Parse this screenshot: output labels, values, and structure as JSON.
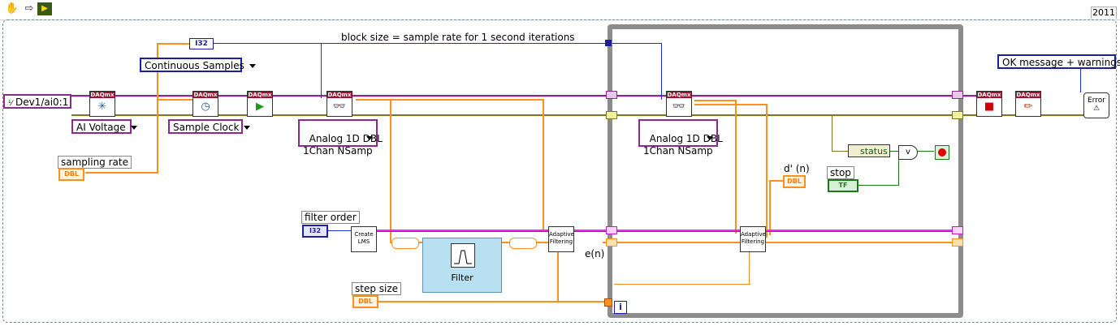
{
  "toolbar": {
    "year_tab": "2011",
    "icons": [
      "hand-icon",
      "arrow-right-icon",
      "run-icon"
    ]
  },
  "diagram": {
    "physical_channel": "Dev1/ai0:1",
    "sample_mode": "Continuous Samples",
    "i32_const": "I32",
    "block_size_comment": "block size = sample rate for 1 second iterations",
    "ai_voltage": "AI Voltage",
    "sample_clock": "Sample Clock",
    "read_poly_1": "Analog 1D DBL\n1Chan NSamp",
    "read_poly_2": "Analog 1D DBL\n1Chan NSamp",
    "sampling_rate_label": "sampling rate",
    "filter_order_label": "filter order",
    "step_size_label": "step size",
    "create_lms": "Create\nLMS",
    "filter_express": "Filter",
    "adaptive_filtering_1": "Adaptive\nFiltering",
    "adaptive_filtering_2": "Adaptive\nFiltering",
    "en_label": "e(n)",
    "dn_label": "d' (n)",
    "status_label": "status",
    "stop_label": "stop",
    "error_option": "OK message + warnings",
    "error_vi": "Error",
    "loop_index": "i",
    "dbl": "DBL",
    "i32": "I32",
    "tf": "TF",
    "daqmx": "DAQmx"
  },
  "colors": {
    "wire_orange": "#ff9020",
    "wire_blue": "#2030d0",
    "wire_pink": "#ff20ff",
    "wire_purple": "#8a2a8a",
    "daqmx_header": "#a0102a",
    "loop_border": "#8c8c8c"
  }
}
